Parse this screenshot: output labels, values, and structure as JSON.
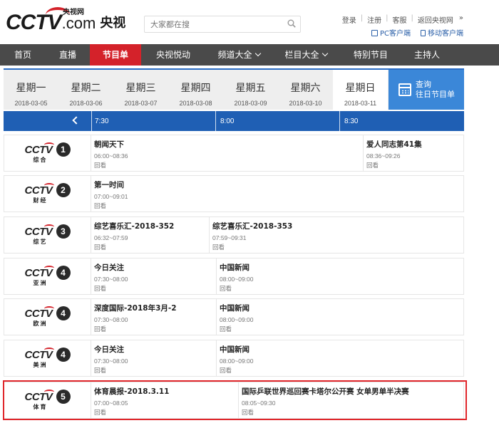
{
  "header": {
    "logo": {
      "cctv": "CCTV",
      "com": ".com",
      "site_cn": "央视网",
      "brand": "央视"
    },
    "search_placeholder": "大家都在搜",
    "top_links": [
      "登录",
      "注册",
      "客服",
      "返回央视网"
    ],
    "client_links": [
      "PC客户端",
      "移动客户端"
    ]
  },
  "nav": {
    "items": [
      {
        "label": "首页",
        "dropdown": false,
        "active": false
      },
      {
        "label": "直播",
        "dropdown": false,
        "active": false
      },
      {
        "label": "节目单",
        "dropdown": false,
        "active": true
      },
      {
        "label": "央视悦动",
        "dropdown": false,
        "active": false
      },
      {
        "label": "频道大全",
        "dropdown": true,
        "active": false
      },
      {
        "label": "栏目大全",
        "dropdown": true,
        "active": false
      },
      {
        "label": "特别节目",
        "dropdown": false,
        "active": false
      },
      {
        "label": "主持人",
        "dropdown": false,
        "active": false
      }
    ]
  },
  "days": [
    {
      "day": "星期一",
      "date": "2018-03-05"
    },
    {
      "day": "星期二",
      "date": "2018-03-06"
    },
    {
      "day": "星期三",
      "date": "2018-03-07"
    },
    {
      "day": "星期四",
      "date": "2018-03-08"
    },
    {
      "day": "星期五",
      "date": "2018-03-09"
    },
    {
      "day": "星期六",
      "date": "2018-03-10"
    },
    {
      "day": "星期日",
      "date": "2018-03-11",
      "selected": true
    }
  ],
  "history": {
    "line1": "查询",
    "line2": "往日节目单"
  },
  "timeline": {
    "labels": [
      "7:30",
      "8:00",
      "8:30"
    ]
  },
  "replay_label": "回看",
  "channels": [
    {
      "num": "1",
      "sub": "综合",
      "programs": [
        {
          "title": "朝闻天下",
          "time": "06:00~08:36"
        },
        {
          "title": "爱人同志第41集",
          "time": "08:36~09:26"
        }
      ]
    },
    {
      "num": "2",
      "sub": "财经",
      "programs": [
        {
          "title": "第一时间",
          "time": "07:00~09:01"
        }
      ]
    },
    {
      "num": "3",
      "sub": "综艺",
      "programs": [
        {
          "title": "综艺喜乐汇-2018-352",
          "time": "06:32~07:59"
        },
        {
          "title": "综艺喜乐汇-2018-353",
          "time": "07:59~09:31"
        }
      ]
    },
    {
      "num": "4",
      "sub": "亚洲",
      "programs": [
        {
          "title": "今日关注",
          "time": "07:30~08:00"
        },
        {
          "title": "中国新闻",
          "time": "08:00~09:00"
        }
      ]
    },
    {
      "num": "4",
      "sub": "欧洲",
      "programs": [
        {
          "title": "深度国际-2018年3月-2",
          "time": "07:30~08:00"
        },
        {
          "title": "中国新闻",
          "time": "08:00~09:00"
        }
      ]
    },
    {
      "num": "4",
      "sub": "美洲",
      "programs": [
        {
          "title": "今日关注",
          "time": "07:30~08:00"
        },
        {
          "title": "中国新闻",
          "time": "08:00~09:00"
        }
      ]
    },
    {
      "num": "5",
      "sub": "体育",
      "programs": [
        {
          "title": "体育晨报-2018.3.11",
          "time": "07:00~08:05"
        },
        {
          "title": "国际乒联世界巡回赛卡塔尔公开赛 女单男单半决赛",
          "time": "08:05~09:30"
        }
      ]
    }
  ],
  "colors": {
    "accent_red": "#d4222a",
    "nav_bg": "#4a4a4a",
    "timeline_bg": "#1f5fb4",
    "history_bg": "#3b87d8"
  }
}
